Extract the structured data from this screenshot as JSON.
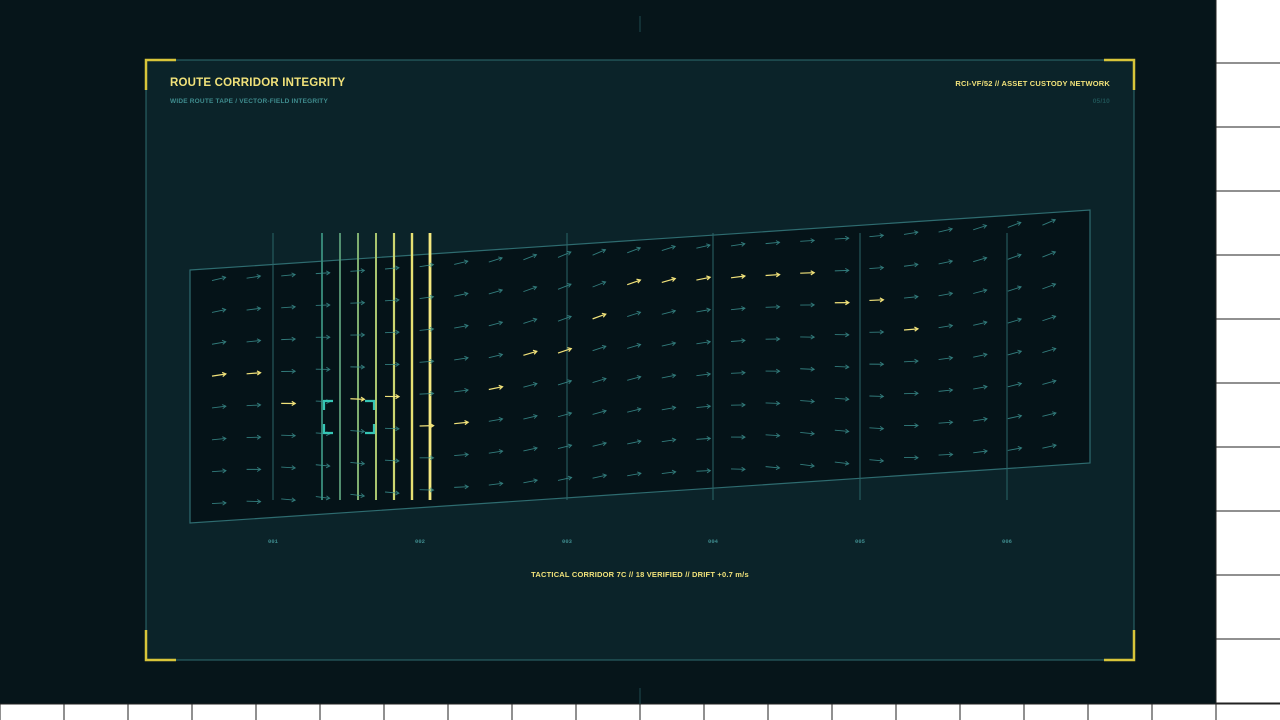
{
  "header": {
    "title": "ROUTE CORRIDOR INTEGRITY",
    "subtitle": "WIDE ROUTE TAPE / VECTOR-FIELD INTEGRITY",
    "panel_id": "RCI-VF/52  //  ASSET CUSTODY NETWORK",
    "page_count": "05/10"
  },
  "tape": {
    "segment_labels": [
      "001",
      "002",
      "003",
      "004",
      "005",
      "006"
    ]
  },
  "status": {
    "line": "TACTICAL CORRIDOR 7C  //  18 VERIFIED  //  DRIFT +0.7 m/s"
  },
  "colors": {
    "background": "#06151a",
    "panel": "#0b2329",
    "frame_line": "#2e6c70",
    "accent_yellow": "#f1e27a",
    "corner_bracket": "#d8c53a",
    "vector_teal": "#3a8f8e",
    "target_bracket": "#35c5b5"
  }
}
